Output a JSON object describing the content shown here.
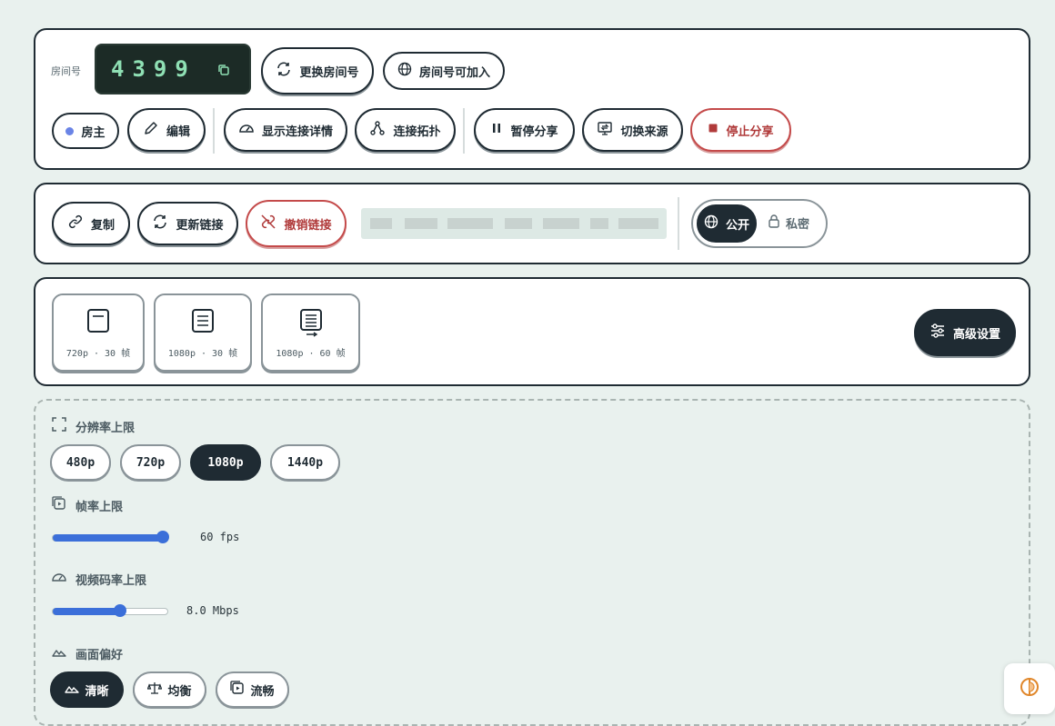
{
  "room": {
    "label": "房间号",
    "code": "4399",
    "change_label": "更换房间号",
    "joinable_label": "房间号可加入"
  },
  "toolbar": {
    "host_label": "房主",
    "edit_label": "编辑",
    "details_label": "显示连接详情",
    "topology_label": "连接拓扑",
    "pause_label": "暂停分享",
    "switch_label": "切换来源",
    "stop_label": "停止分享"
  },
  "link": {
    "copy_label": "复制",
    "refresh_label": "更新链接",
    "revoke_label": "撤销链接",
    "public_label": "公开",
    "private_label": "私密",
    "visibility": "public"
  },
  "presets": {
    "items": [
      {
        "label": "720p · 30 帧",
        "icon": "doc-icon"
      },
      {
        "label": "1080p · 30 帧",
        "icon": "doc-lines-icon"
      },
      {
        "label": "1080p · 60 帧",
        "icon": "doc-arrow-icon"
      }
    ],
    "advanced_label": "高级设置"
  },
  "advanced": {
    "resolution": {
      "title": "分辨率上限",
      "options": [
        "480p",
        "720p",
        "1080p",
        "1440p"
      ],
      "selected": "1080p"
    },
    "framerate": {
      "title": "帧率上限",
      "value_text": "60 fps",
      "fraction": 1.0
    },
    "bitrate": {
      "title": "视频码率上限",
      "value_text": "8.0 Mbps",
      "fraction": 0.59
    },
    "preference": {
      "title": "画面偏好",
      "options": [
        "清晰",
        "均衡",
        "流畅"
      ],
      "selected": "清晰"
    }
  },
  "colors": {
    "accent": "#3b6fd9",
    "dark": "#1f2b33",
    "danger": "#c44a4a",
    "background": "#e9f1ee"
  }
}
